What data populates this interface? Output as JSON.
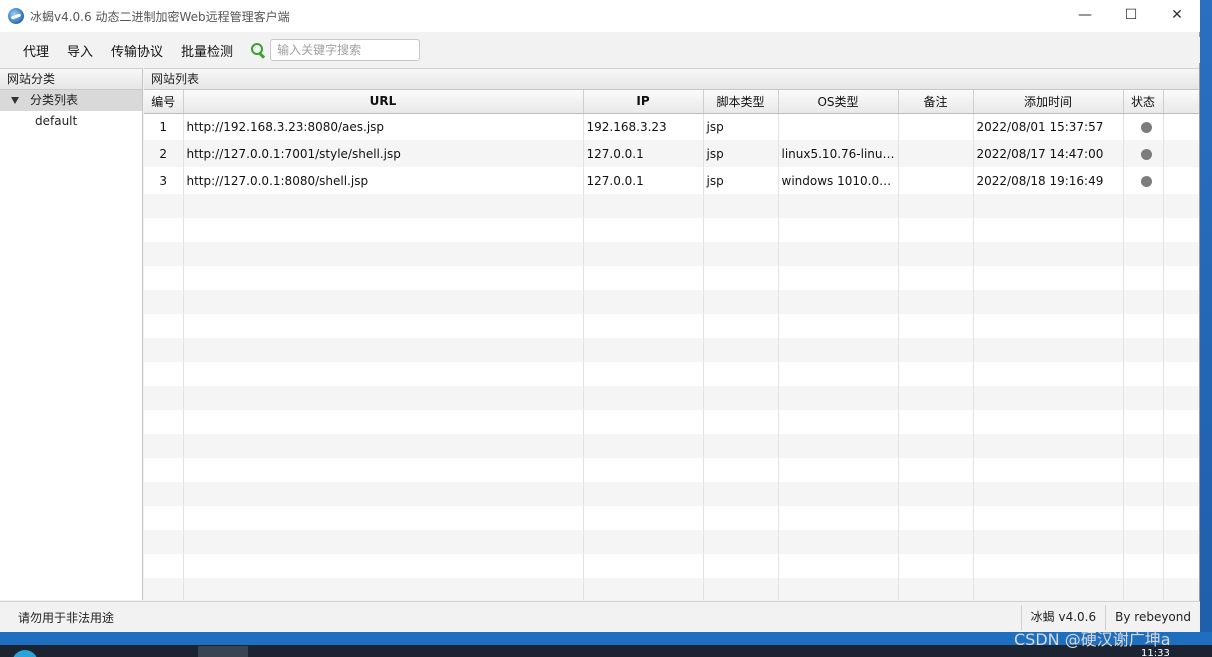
{
  "window": {
    "title": "冰蝎v4.0.6 动态二进制加密Web远程管理客户端",
    "minimize": "—",
    "maximize": "☐",
    "close": "✕"
  },
  "menu": {
    "items": [
      "代理",
      "导入",
      "传输协议",
      "批量检测"
    ],
    "search_placeholder": "输入关键字搜索",
    "search_icon": "search-icon"
  },
  "left_panel": {
    "header": "网站分类",
    "tree_root": "分类列表",
    "tree_children": [
      "default"
    ]
  },
  "right_panel": {
    "header": "网站列表",
    "columns": [
      "编号",
      "URL",
      "IP",
      "脚本类型",
      "OS类型",
      "备注",
      "添加时间",
      "状态"
    ],
    "rows": [
      {
        "id": "1",
        "url": "http://192.168.3.23:8080/aes.jsp",
        "ip": "192.168.3.23",
        "type": "jsp",
        "os": "",
        "note": "",
        "time": "2022/08/01 15:37:57",
        "status": "offline"
      },
      {
        "id": "2",
        "url": "http://127.0.0.1:7001/style/shell.jsp",
        "ip": "127.0.0.1",
        "type": "jsp",
        "os": "linux5.10.76-linuxk...",
        "note": "",
        "time": "2022/08/17 14:47:00",
        "status": "offline"
      },
      {
        "id": "3",
        "url": "http://127.0.0.1:8080/shell.jsp",
        "ip": "127.0.0.1",
        "type": "jsp",
        "os": "windows 1010.0a...",
        "note": "",
        "time": "2022/08/18 19:16:49",
        "status": "offline"
      }
    ]
  },
  "statusbar": {
    "warning": "请勿用于非法用途",
    "version": "冰蝎 v4.0.6",
    "author": "By rebeyond"
  },
  "taskbar": {
    "watermark": "CSDN @硬汉谢广坤a",
    "clock": "11:33"
  },
  "colors": {
    "status_dot": "#7c7c7c",
    "search_icon": "#3aa02e",
    "desktop": "#2f7fd0"
  }
}
